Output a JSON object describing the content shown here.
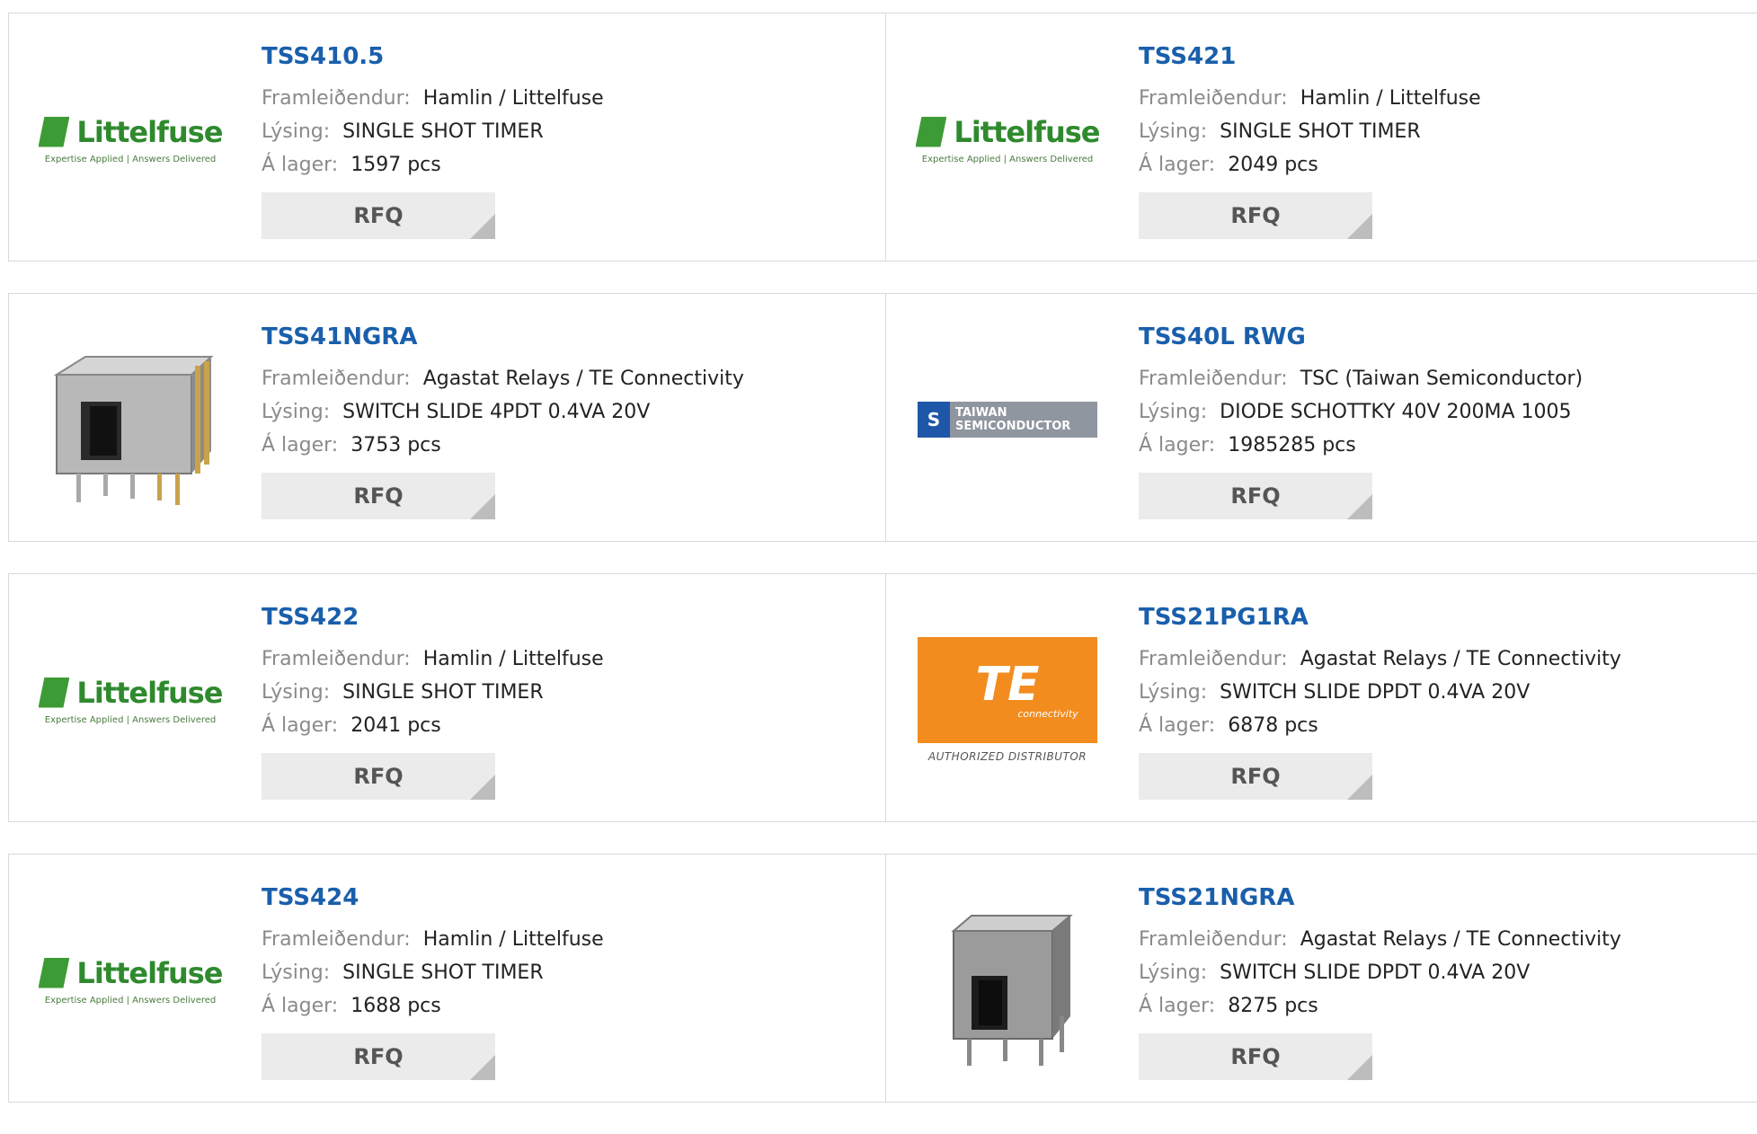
{
  "labels": {
    "manufacturer": "Framleiðendur:",
    "description": "Lýsing:",
    "stock": "Á lager:",
    "rfq": "RFQ"
  },
  "products": [
    {
      "part": "TSS410.5",
      "manufacturer": "Hamlin / Littelfuse",
      "description": "SINGLE SHOT TIMER",
      "stock": "1597 pcs",
      "image": "littelfuse-logo"
    },
    {
      "part": "TSS421",
      "manufacturer": "Hamlin / Littelfuse",
      "description": "SINGLE SHOT TIMER",
      "stock": "2049 pcs",
      "image": "littelfuse-logo"
    },
    {
      "part": "TSS41NGRA",
      "manufacturer": "Agastat Relays / TE Connectivity",
      "description": "SWITCH SLIDE 4PDT 0.4VA 20V",
      "stock": "3753 pcs",
      "image": "slide-switch-photo"
    },
    {
      "part": "TSS40L RWG",
      "manufacturer": "TSC (Taiwan Semiconductor)",
      "description": "DIODE SCHOTTKY 40V 200MA 1005",
      "stock": "1985285 pcs",
      "image": "taiwan-semiconductor-logo"
    },
    {
      "part": "TSS422",
      "manufacturer": "Hamlin / Littelfuse",
      "description": "SINGLE SHOT TIMER",
      "stock": "2041 pcs",
      "image": "littelfuse-logo"
    },
    {
      "part": "TSS21PG1RA",
      "manufacturer": "Agastat Relays / TE Connectivity",
      "description": "SWITCH SLIDE DPDT 0.4VA 20V",
      "stock": "6878 pcs",
      "image": "te-connectivity-logo"
    },
    {
      "part": "TSS424",
      "manufacturer": "Hamlin / Littelfuse",
      "description": "SINGLE SHOT TIMER",
      "stock": "1688 pcs",
      "image": "littelfuse-logo"
    },
    {
      "part": "TSS21NGRA",
      "manufacturer": "Agastat Relays / TE Connectivity",
      "description": "SWITCH SLIDE DPDT 0.4VA 20V",
      "stock": "8275 pcs",
      "image": "slide-switch-photo"
    }
  ],
  "logos": {
    "littelfuse": {
      "name": "Littelfuse",
      "tagline": "Expertise Applied | Answers Delivered"
    },
    "taiwan": {
      "line1": "TAIWAN",
      "line2": "SEMICONDUCTOR"
    },
    "te": {
      "name": "TE",
      "sub": "connectivity",
      "badge": "AUTHORIZED DISTRIBUTOR"
    }
  },
  "colors": {
    "part_link": "#1a5fab",
    "label_gray": "#8a8a8a",
    "rfq_bg": "#ebebeb",
    "littelfuse_green": "#2f8a2e",
    "te_orange": "#f28c1f"
  }
}
